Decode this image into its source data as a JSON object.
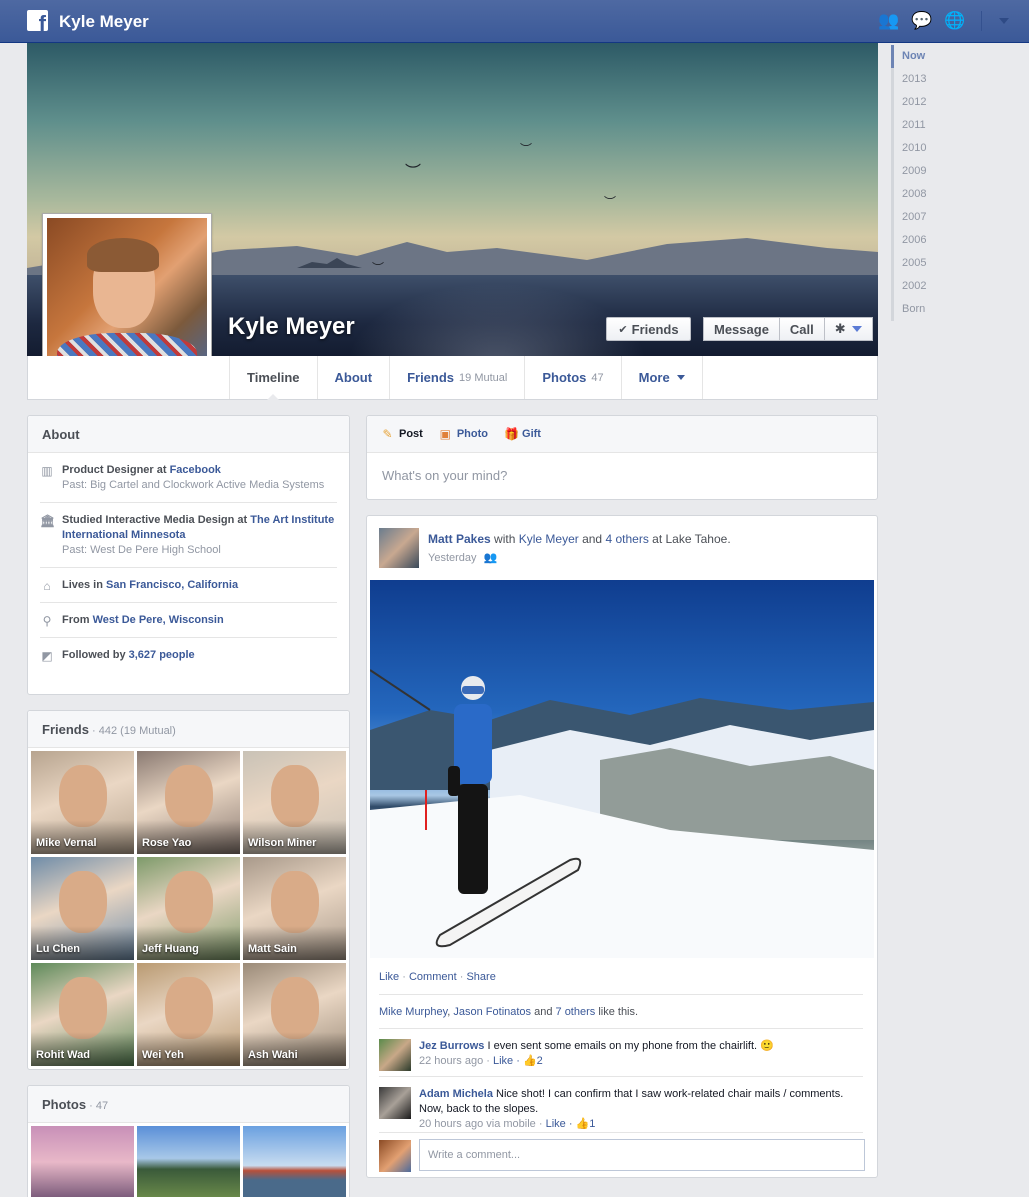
{
  "topbar": {
    "title": "Kyle Meyer"
  },
  "profile": {
    "name": "Kyle Meyer",
    "buttons": {
      "friends": "Friends",
      "message": "Message",
      "call": "Call"
    }
  },
  "tabs": [
    {
      "label": "Timeline",
      "count": ""
    },
    {
      "label": "About",
      "count": ""
    },
    {
      "label": "Friends",
      "count": "19 Mutual"
    },
    {
      "label": "Photos",
      "count": "47"
    },
    {
      "label": "More",
      "count": ""
    }
  ],
  "years": [
    "Now",
    "2013",
    "2012",
    "2011",
    "2010",
    "2009",
    "2008",
    "2007",
    "2006",
    "2005",
    "2002",
    "Born"
  ],
  "about": {
    "title": "About",
    "work": {
      "pre": "Product Designer at ",
      "link": "Facebook",
      "past": "Past: Big Cartel and Clockwork Active Media Systems"
    },
    "edu": {
      "pre": "Studied Interactive Media Design at ",
      "link": "The Art Institute International Minnesota",
      "past": "Past: West De Pere High School"
    },
    "lives": {
      "pre": "Lives in ",
      "link": "San Francisco, California"
    },
    "from": {
      "pre": "From ",
      "link": "West De Pere, Wisconsin"
    },
    "followed": {
      "pre": "Followed by ",
      "link": "3,627 people"
    }
  },
  "friends_panel": {
    "title": "Friends",
    "sub": " · 442 (19 Mutual)",
    "people": [
      {
        "name": "Mike Vernal",
        "bg": "#b7a48f"
      },
      {
        "name": "Rose Yao",
        "bg": "#8a7a72"
      },
      {
        "name": "Wilson Miner",
        "bg": "#c9c2b6"
      },
      {
        "name": "Lu Chen",
        "bg": "#6f8ca8"
      },
      {
        "name": "Jeff Huang",
        "bg": "#7d9a6a"
      },
      {
        "name": "Matt Sain",
        "bg": "#a8998a"
      },
      {
        "name": "Rohit Wad",
        "bg": "#5e8a5a"
      },
      {
        "name": "Wei Yeh",
        "bg": "#b99a72"
      },
      {
        "name": "Ash Wahi",
        "bg": "#9a8a78"
      }
    ]
  },
  "photos_panel": {
    "title": "Photos",
    "sub": " · 47"
  },
  "composer": {
    "tabs": {
      "post": "Post",
      "photo": "Photo",
      "gift": "Gift"
    },
    "placeholder": "What's on your mind?"
  },
  "story": {
    "author": "Matt Pakes",
    "with": " with ",
    "tagged": "Kyle Meyer",
    "and": " and ",
    "others": "4 others",
    "at": " at Lake Tahoe.",
    "time": "Yesterday",
    "actions": {
      "like": "Like",
      "comment": "Comment",
      "share": "Share"
    },
    "likes": {
      "a": "Mike Murphey",
      "b": "Jason Fotinatos",
      "mid": " and ",
      "c": "7 others",
      "tail": " like this."
    },
    "comments": [
      {
        "name": "Jez Burrows",
        "text": " I even sent some emails on my phone from the chairlift. 🙂",
        "meta": "22 hours ago · ",
        "like": "Like",
        "count": "· 👍2"
      },
      {
        "name": "Adam Michela",
        "text": " Nice shot! I can confirm that I saw work-related chair mails / comments. Now, back to the slopes.",
        "meta": "20 hours ago via mobile · ",
        "like": "Like",
        "count": "· 👍1"
      }
    ],
    "write_placeholder": "Write a comment..."
  }
}
